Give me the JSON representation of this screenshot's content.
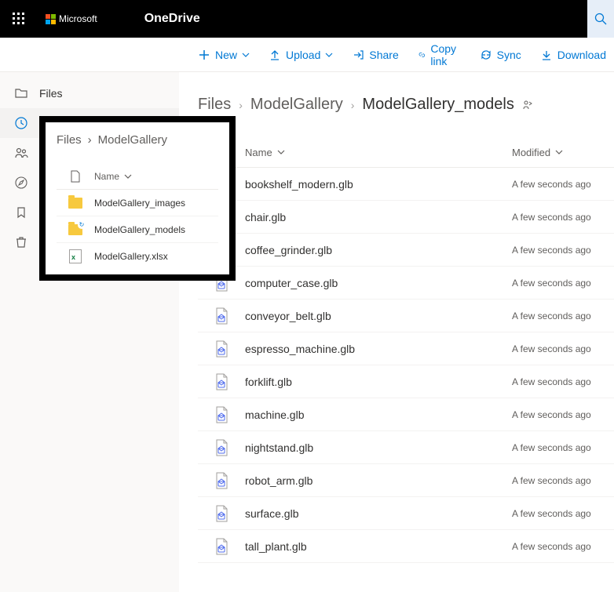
{
  "header": {
    "vendor": "Microsoft",
    "app": "OneDrive"
  },
  "commands": {
    "new": "New",
    "upload": "Upload",
    "share": "Share",
    "copylink": "Copy link",
    "sync": "Sync",
    "download": "Download"
  },
  "sidebar": {
    "items": [
      {
        "label": "Files"
      },
      {
        "label": "Recent"
      },
      {
        "label": "Shared"
      }
    ]
  },
  "breadcrumb": {
    "root": "Files",
    "mid": "ModelGallery",
    "current": "ModelGallery_models"
  },
  "columns": {
    "name": "Name",
    "modified": "Modified"
  },
  "files": [
    {
      "name": "bookshelf_modern.glb",
      "modified": "A few seconds ago"
    },
    {
      "name": "chair.glb",
      "modified": "A few seconds ago"
    },
    {
      "name": "coffee_grinder.glb",
      "modified": "A few seconds ago"
    },
    {
      "name": "computer_case.glb",
      "modified": "A few seconds ago"
    },
    {
      "name": "conveyor_belt.glb",
      "modified": "A few seconds ago"
    },
    {
      "name": "espresso_machine.glb",
      "modified": "A few seconds ago"
    },
    {
      "name": "forklift.glb",
      "modified": "A few seconds ago"
    },
    {
      "name": "machine.glb",
      "modified": "A few seconds ago"
    },
    {
      "name": "nightstand.glb",
      "modified": "A few seconds ago"
    },
    {
      "name": "robot_arm.glb",
      "modified": "A few seconds ago"
    },
    {
      "name": "surface.glb",
      "modified": "A few seconds ago"
    },
    {
      "name": "tall_plant.glb",
      "modified": "A few seconds ago"
    }
  ],
  "inset": {
    "bc_root": "Files",
    "bc_current": "ModelGallery",
    "col_name": "Name",
    "rows": [
      {
        "name": "ModelGallery_images",
        "type": "folder"
      },
      {
        "name": "ModelGallery_models",
        "type": "folder-sync"
      },
      {
        "name": "ModelGallery.xlsx",
        "type": "xlsx"
      }
    ]
  }
}
